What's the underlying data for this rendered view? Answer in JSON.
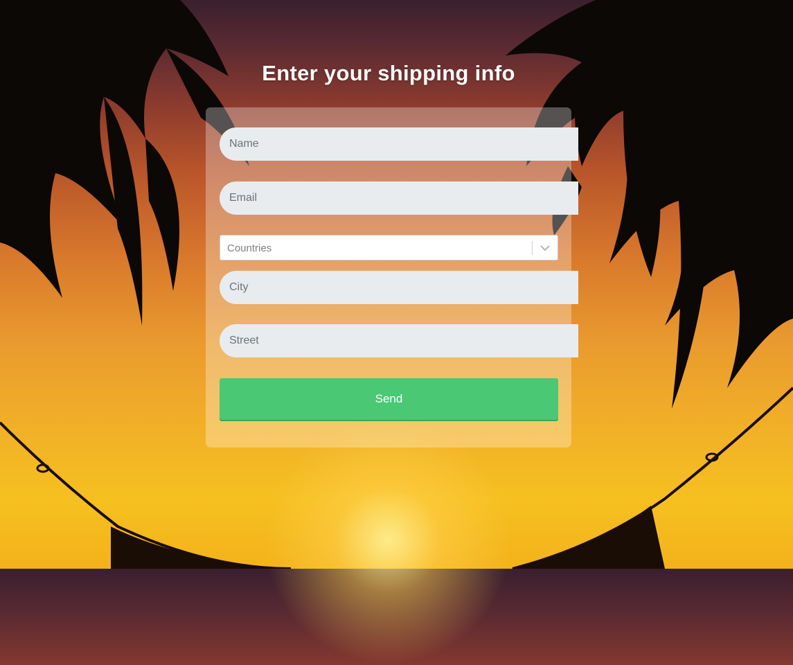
{
  "form": {
    "title": "Enter your shipping info",
    "name_placeholder": "Name",
    "email_placeholder": "Email",
    "countries_placeholder": "Countries",
    "city_placeholder": "City",
    "street_placeholder": "Street",
    "send_label": "Send"
  },
  "icons": {
    "countries_dropdown": "chevron-down-icon"
  },
  "colors": {
    "send_button": "#4ac874",
    "input_background": "#e8ecef",
    "card_overlay": "rgba(255,255,255,0.30)"
  }
}
